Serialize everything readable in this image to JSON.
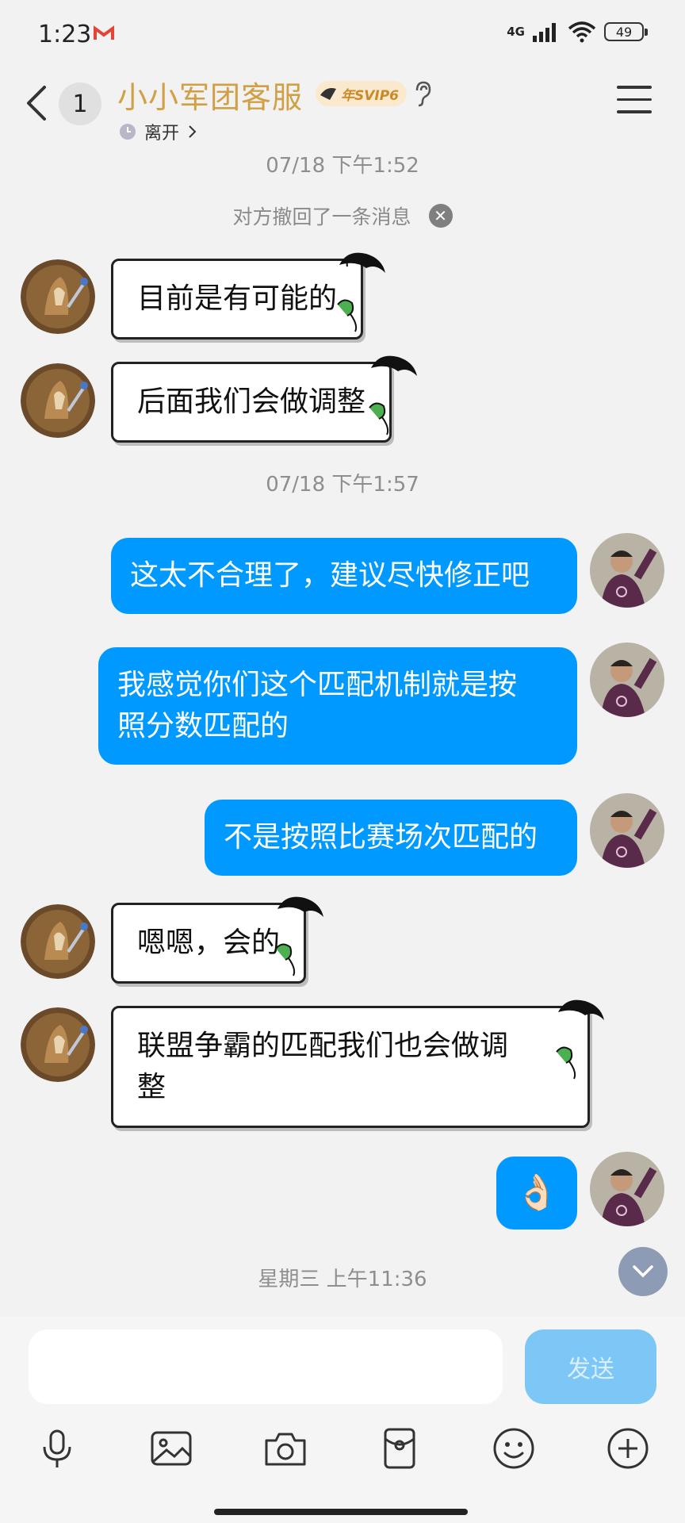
{
  "status_bar": {
    "time": "1:23",
    "network": "4G",
    "battery": "49"
  },
  "header": {
    "unread_count": "1",
    "title": "小小军团客服",
    "badge": "年SVIP6",
    "presence": "离开"
  },
  "messages": {
    "ts1": "07/18 下午1:52",
    "system_recall": "对方撤回了一条消息",
    "m1": "目前是有可能的",
    "m2": "后面我们会做调整",
    "ts2": "07/18 下午1:57",
    "m3": "这太不合理了，建议尽快修正吧",
    "m4_line1": "我感觉你们这个匹配机制就是按",
    "m4_line2": "照分数匹配的",
    "m5": "不是按照比赛场次匹配的",
    "m6": "嗯嗯，会的",
    "m7_line1": "联盟争霸的匹配我们也会做调",
    "m7_line2": "整",
    "m8_emoji": "👌🏻",
    "ts3": "星期三 上午11:36"
  },
  "input": {
    "send_label": "发送"
  },
  "toolbar": {
    "icons": [
      "microphone-icon",
      "image-icon",
      "camera-icon",
      "red-packet-icon",
      "emoji-icon",
      "plus-icon"
    ]
  },
  "colors": {
    "accent_blue": "#0099ff",
    "title_gold": "#d1a045"
  }
}
